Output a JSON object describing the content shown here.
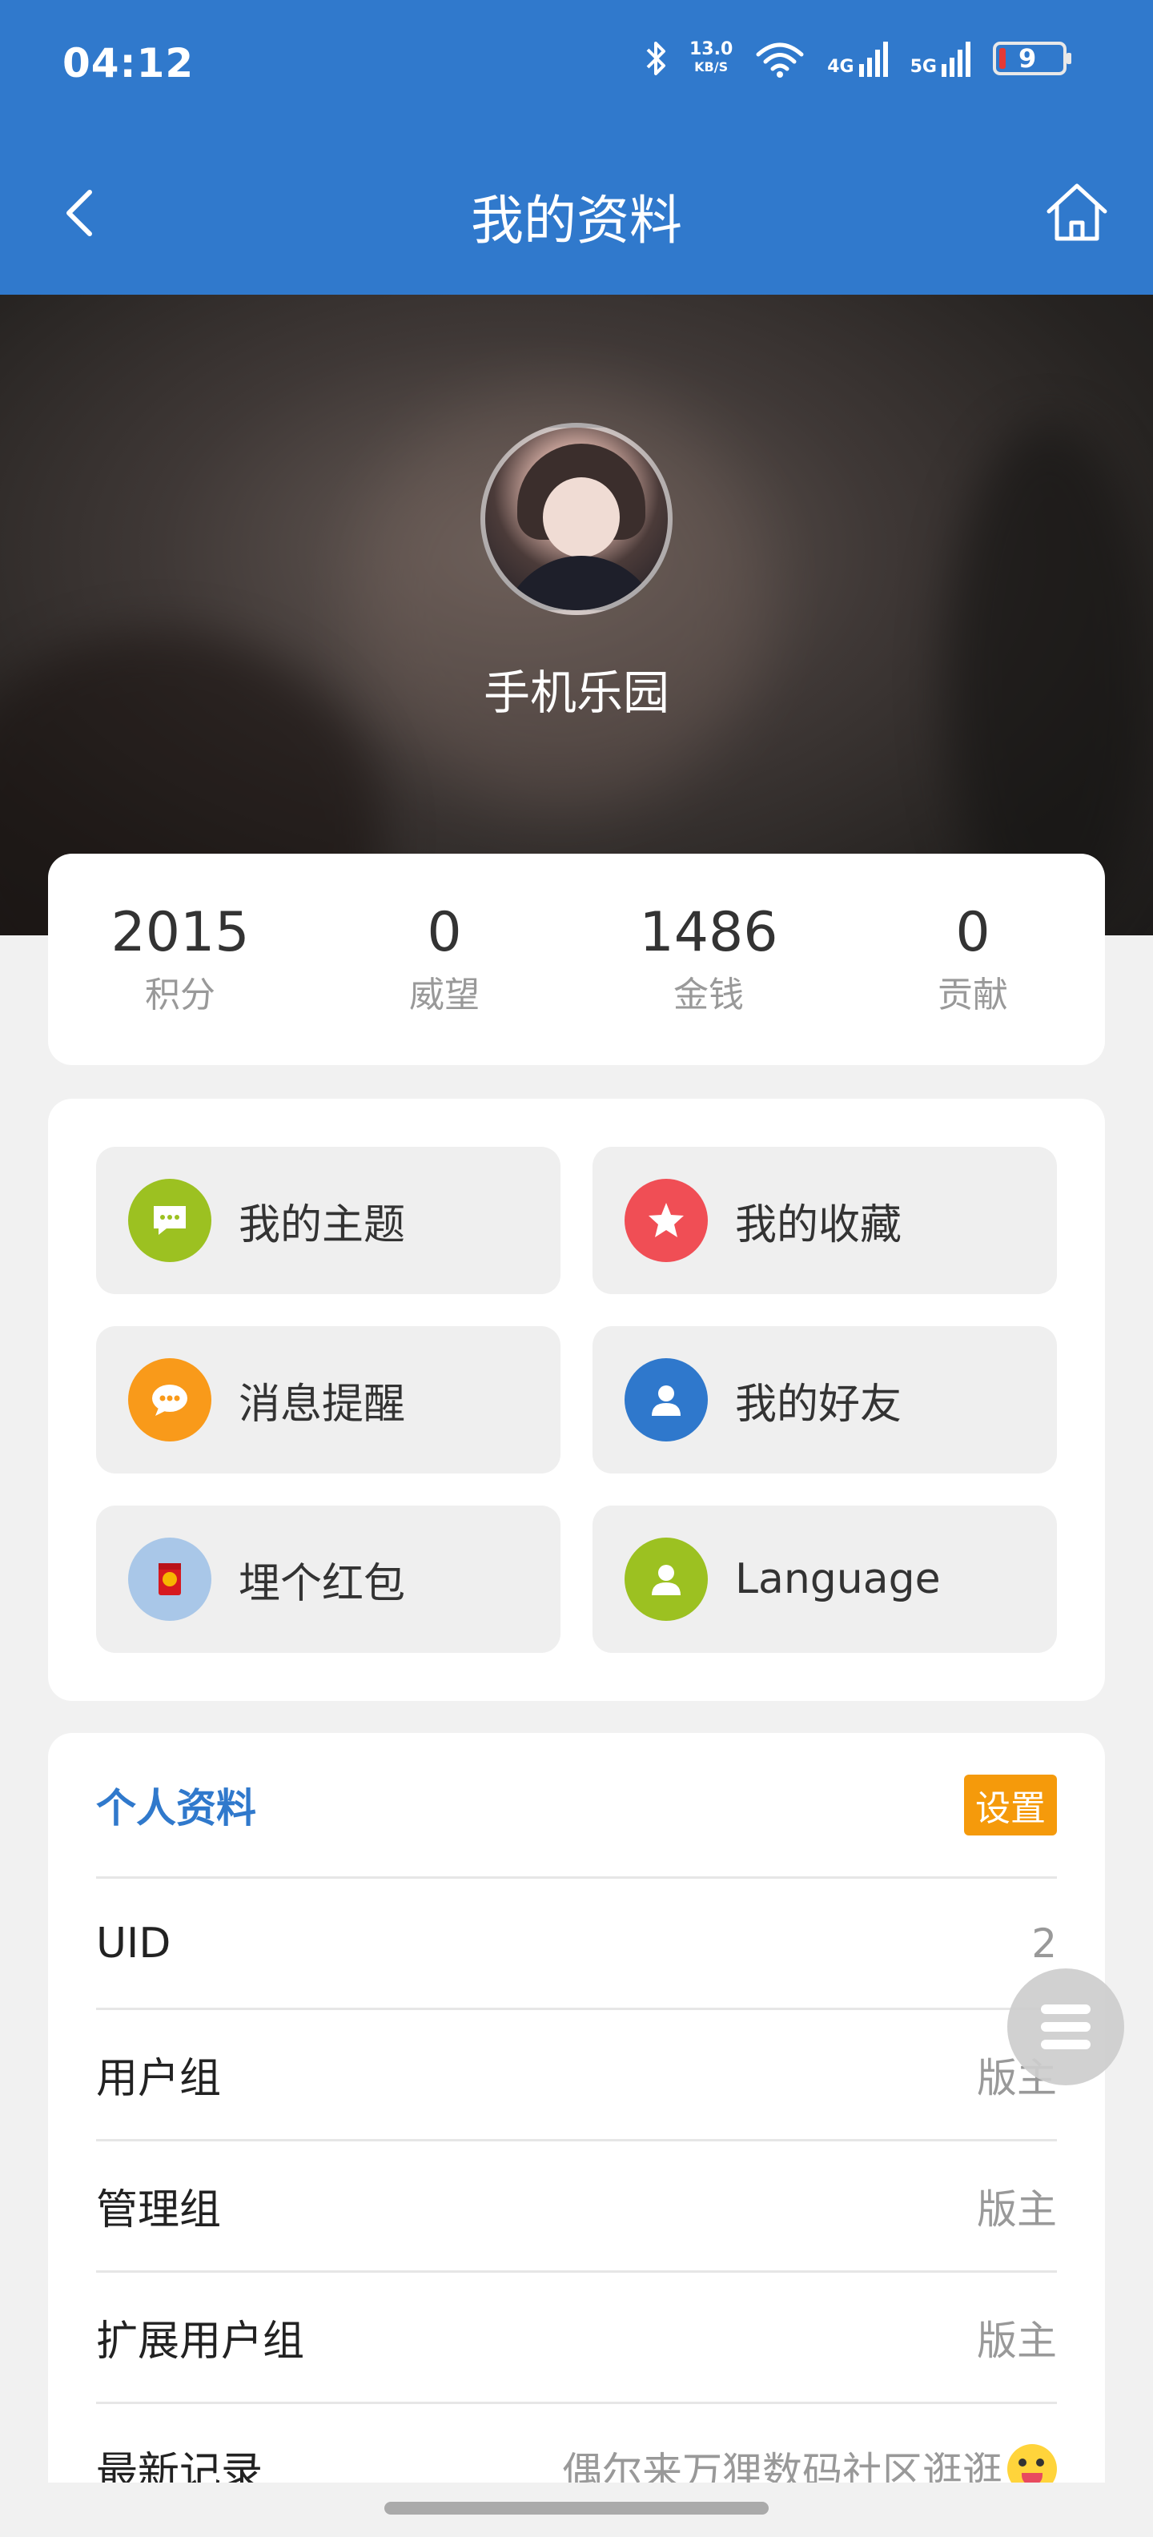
{
  "status_bar": {
    "time": "04:12",
    "net_speed": "13.0",
    "net_speed_unit": "KB/S",
    "net_4g": "4G",
    "net_5g": "5G",
    "battery_level": "9"
  },
  "header": {
    "title": "我的资料",
    "back_icon": "chevron-left-icon",
    "home_icon": "home-icon"
  },
  "profile_hero": {
    "username": "手机乐园"
  },
  "stats": [
    {
      "value": "2015",
      "label": "积分"
    },
    {
      "value": "0",
      "label": "威望"
    },
    {
      "value": "1486",
      "label": "金钱"
    },
    {
      "value": "0",
      "label": "贡献"
    }
  ],
  "menu": [
    {
      "label": "我的主题",
      "icon": "message-icon",
      "color": "#9cc121"
    },
    {
      "label": "我的收藏",
      "icon": "star-icon",
      "color": "#f04e55"
    },
    {
      "label": "消息提醒",
      "icon": "chat-bubble-icon",
      "color": "#f99a1a"
    },
    {
      "label": "我的好友",
      "icon": "user-icon",
      "color": "#2f78cc"
    },
    {
      "label": "埋个红包",
      "icon": "red-envelope-icon",
      "color": "#a9c7e8"
    },
    {
      "label": "Language",
      "icon": "user-icon",
      "color": "#9cc121"
    }
  ],
  "personal_info": {
    "title": "个人资料",
    "settings_label": "设置",
    "rows": [
      {
        "key": "UID",
        "value": "2"
      },
      {
        "key": "用户组",
        "value": "版主"
      },
      {
        "key": "管理组",
        "value": "版主"
      },
      {
        "key": "扩展用户组",
        "value": "版主"
      },
      {
        "key": "最新记录",
        "value": "偶尔来万狸数码社区逛逛"
      }
    ]
  },
  "colors": {
    "brand": "#3079cc",
    "accent_orange": "#f59a0b"
  }
}
